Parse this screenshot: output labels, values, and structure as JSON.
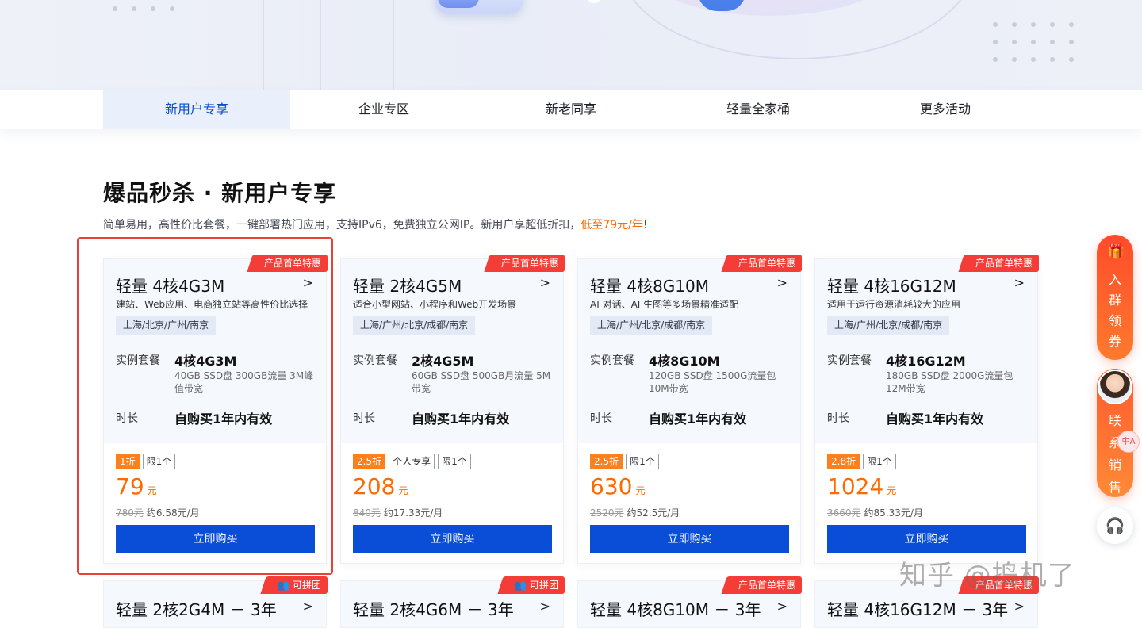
{
  "tabs": [
    {
      "label": "新用户专享",
      "active": true
    },
    {
      "label": "企业专区",
      "active": false
    },
    {
      "label": "新老同享",
      "active": false
    },
    {
      "label": "轻量全家桶",
      "active": false
    },
    {
      "label": "更多活动",
      "active": false
    }
  ],
  "section": {
    "title": "爆品秒杀 · 新用户专享",
    "subtitle": "简单易用，高性价比套餐，一键部署热门应用，支持IPv6，免费独立公网IP。新用户享超低折扣，",
    "subtitle_highlight": "低至79元/年",
    "subtitle_end": "!"
  },
  "labels": {
    "spec": "实例套餐",
    "duration": "时长",
    "buy": "立即购买",
    "chevron": ">",
    "yuan": "元"
  },
  "cards": [
    {
      "ribbon": "产品首单特惠",
      "name": "轻量 4核4G3M",
      "desc": "建站、Web应用、电商独立站等高性价比选择",
      "region": "上海/北京/广州/南京",
      "spec_main": "4核4G3M",
      "spec_sub": "40GB SSD盘 300GB流量 3M峰值带宽",
      "duration": "自购买1年内有效",
      "tags": [
        {
          "text": "1折",
          "discount": true
        },
        {
          "text": "限1个",
          "discount": false
        }
      ],
      "price": "79",
      "orig_price": "780元",
      "monthly": "约6.58元/月"
    },
    {
      "ribbon": "产品首单特惠",
      "name": "轻量 2核4G5M",
      "desc": "适合小型网站、小程序和Web开发场景",
      "region": "上海/广州/北京/成都/南京",
      "spec_main": "2核4G5M",
      "spec_sub": "60GB SSD盘 500GB月流量 5M带宽",
      "duration": "自购买1年内有效",
      "tags": [
        {
          "text": "2.5折",
          "discount": true
        },
        {
          "text": "个人专享",
          "discount": false
        },
        {
          "text": "限1个",
          "discount": false
        }
      ],
      "price": "208",
      "orig_price": "840元",
      "monthly": "约17.33元/月"
    },
    {
      "ribbon": "产品首单特惠",
      "name": "轻量 4核8G10M",
      "desc": "AI 对话、AI 生图等多场景精准适配",
      "region": "上海/广州/北京/成都/南京",
      "spec_main": "4核8G10M",
      "spec_sub": "120GB SSD盘 1500G流量包 10M带宽",
      "duration": "自购买1年内有效",
      "tags": [
        {
          "text": "2.5折",
          "discount": true
        },
        {
          "text": "限1个",
          "discount": false
        }
      ],
      "price": "630",
      "orig_price": "2520元",
      "monthly": "约52.5元/月"
    },
    {
      "ribbon": "产品首单特惠",
      "name": "轻量 4核16G12M",
      "desc": "适用于运行资源消耗较大的应用",
      "region": "上海/广州/北京/成都/南京",
      "spec_main": "4核16G12M",
      "spec_sub": "180GB SSD盘 2000G流量包 12M带宽",
      "duration": "自购买1年内有效",
      "tags": [
        {
          "text": "2.8折",
          "discount": true
        },
        {
          "text": "限1个",
          "discount": false
        }
      ],
      "price": "1024",
      "orig_price": "3660元",
      "monthly": "约85.33元/月"
    }
  ],
  "cards_row2": [
    {
      "ribbon": "可拼团",
      "ribbon_type": "group",
      "name": "轻量 2核2G4M － 3年"
    },
    {
      "ribbon": "可拼团",
      "ribbon_type": "group",
      "name": "轻量 2核4G6M － 3年"
    },
    {
      "ribbon": "产品首单特惠",
      "ribbon_type": "first",
      "name": "轻量 4核8G10M － 3年"
    },
    {
      "ribbon": "产品首单特惠",
      "ribbon_type": "first",
      "name": "轻量 4核16G12M － 3年"
    }
  ],
  "float": {
    "coupon_text": "入群领券",
    "sales_text": "联系销售",
    "sales_badge": "中A"
  },
  "watermark": "知乎 @捣机了",
  "colors": {
    "accent_blue": "#0a4ed8",
    "orange": "#ff6a00",
    "ribbon_red": "#f43d36",
    "highlight_red": "#e8413a"
  }
}
